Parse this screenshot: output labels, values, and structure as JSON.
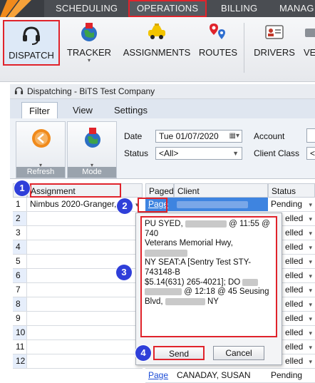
{
  "topnav": {
    "tabs": [
      "SCHEDULING",
      "OPERATIONS",
      "BILLING",
      "MANAG"
    ]
  },
  "ribbon": {
    "buttons": [
      {
        "label": "DISPATCH",
        "icon": "headset-icon"
      },
      {
        "label": "TRACKER",
        "icon": "globe-pin-icon"
      },
      {
        "label": "ASSIGNMENTS",
        "icon": "taxi-icon"
      },
      {
        "label": "ROUTES",
        "icon": "map-pins-icon"
      },
      {
        "label": "DRIVERS",
        "icon": "id-card-icon"
      },
      {
        "label": "VE",
        "icon": "vehicle-icon"
      }
    ]
  },
  "window": {
    "title": "Dispatching - BiTS Test Company",
    "tabs": [
      "Filter",
      "View",
      "Settings"
    ]
  },
  "filter": {
    "refresh_caption": "Refresh",
    "mode_caption": "Mode",
    "date_label": "Date",
    "date_value": "Tue 01/07/2020",
    "status_label": "Status",
    "status_value": "<All>",
    "account_label": "Account",
    "client_class_label": "Client Class",
    "client_class_value": "<"
  },
  "left_grid": {
    "header": "Assignment",
    "rows": [
      {
        "num": "1",
        "value": "Nimbus 2020-Granger, ..."
      },
      {
        "num": "2",
        "value": ""
      },
      {
        "num": "3",
        "value": ""
      },
      {
        "num": "4",
        "value": ""
      },
      {
        "num": "5",
        "value": ""
      },
      {
        "num": "6",
        "value": ""
      },
      {
        "num": "7",
        "value": ""
      },
      {
        "num": "8",
        "value": ""
      },
      {
        "num": "9",
        "value": ""
      },
      {
        "num": "10",
        "value": ""
      },
      {
        "num": "11",
        "value": ""
      },
      {
        "num": "12",
        "value": ""
      }
    ]
  },
  "right_grid": {
    "headers": [
      "Paged",
      "Client",
      "Status"
    ],
    "first_row": {
      "paged": "Page",
      "status": "Pending"
    },
    "status_values": [
      "elled",
      "elled",
      "elled",
      "elled",
      "elled",
      "elled",
      "elled",
      "elled",
      "elled",
      "elled",
      "elled"
    ],
    "last_row": {
      "paged": "Page",
      "client": "CANADAY, SUSAN",
      "status": "Pending"
    }
  },
  "page_popup": {
    "message_parts": {
      "p1": "PU SYED,",
      "p2": "@ 11:55 @ 740",
      "p3": "Veterans Memorial Hwy,",
      "p4": "NY SEAT:A [Sentry Test STY-743148-B",
      "p5": "$5.14(631) 265-4021]; DO",
      "p6": "@ 12:18 @ 45 Seusing",
      "p7": "Blvd,",
      "p8": "NY"
    },
    "send_label": "Send",
    "cancel_label": "Cancel"
  },
  "callouts": [
    "1",
    "2",
    "3",
    "4"
  ],
  "colors": {
    "highlight_red": "#e0232b",
    "callout_blue": "#2f3fd9",
    "selection_blue": "#3e84e0",
    "nav_bg": "#4a4d52"
  }
}
